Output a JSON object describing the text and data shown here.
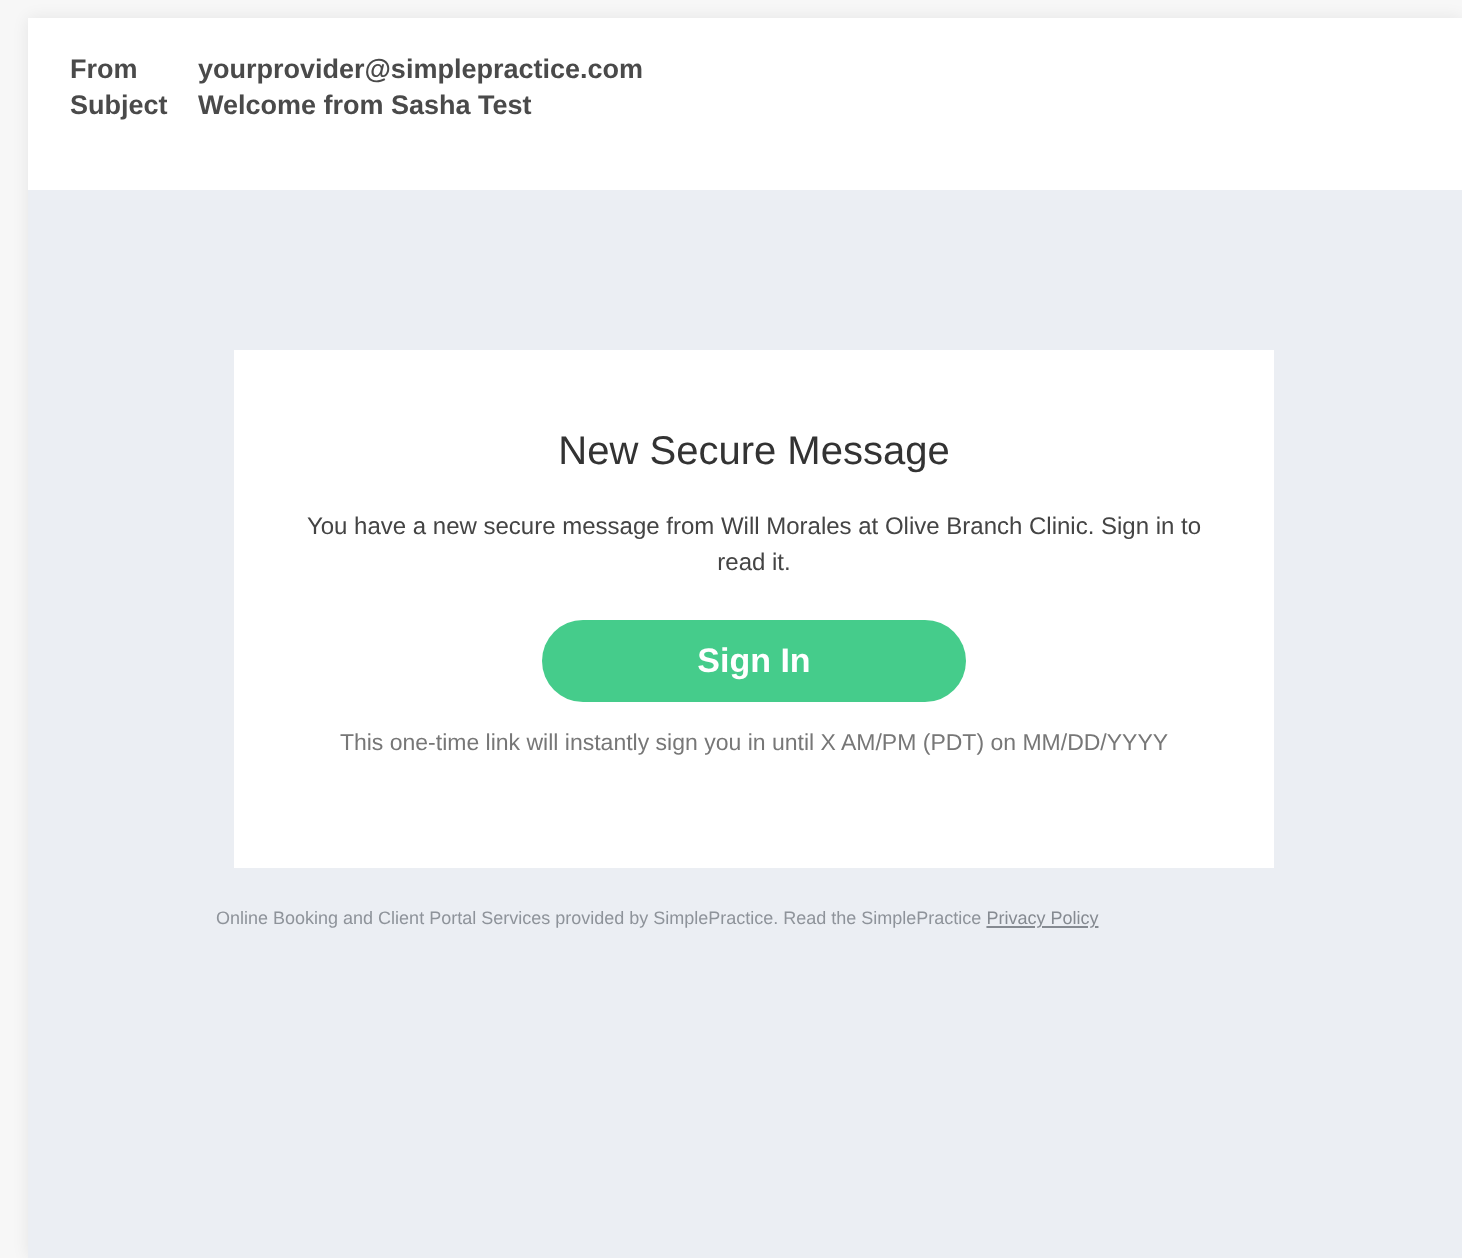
{
  "header": {
    "fields": [
      {
        "label": "From",
        "value": "yourprovider@simplepractice.com"
      },
      {
        "label": "Subject",
        "value": "Welcome from Sasha Test"
      }
    ]
  },
  "card": {
    "title": "New Secure Message",
    "message": "You have a new secure message from Will Morales at Olive Branch Clinic. Sign in to read it.",
    "button": "Sign In",
    "note": "This one-time link will instantly sign you in until X AM/PM (PDT) on MM/DD/YYYY"
  },
  "footer": {
    "text": "Online Booking and Client Portal Services provided by SimplePractice. Read the SimplePractice",
    "link": "Privacy Policy"
  }
}
